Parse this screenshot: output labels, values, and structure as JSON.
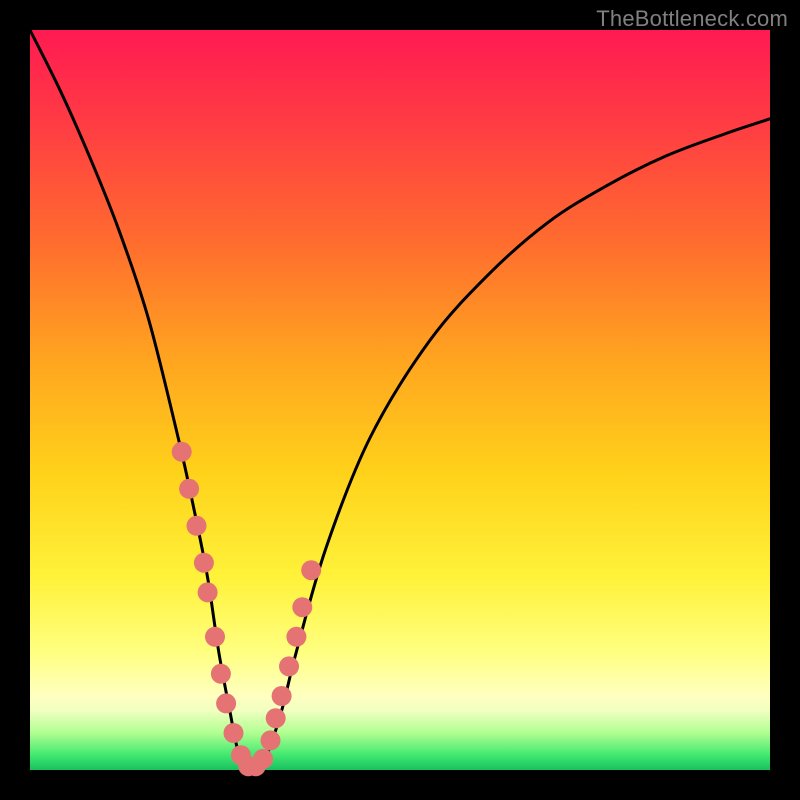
{
  "watermark": "TheBottleneck.com",
  "colors": {
    "background": "#000000",
    "curve_stroke": "#000000",
    "marker_fill": "#e57373",
    "marker_stroke": "#c85858",
    "watermark_text": "#808080"
  },
  "chart_data": {
    "type": "line",
    "title": "",
    "xlabel": "",
    "ylabel": "",
    "xlim": [
      0,
      100
    ],
    "ylim": [
      0,
      100
    ],
    "grid": false,
    "legend": false,
    "curve_comment": "V-shaped bottleneck curve; y≈0 at the notch, rises steeply toward 100 away from it. Values estimated from pixel positions.",
    "x": [
      0,
      4,
      8,
      12,
      16,
      20,
      22,
      24,
      25.5,
      27,
      28,
      29,
      30,
      31,
      32,
      34,
      36,
      40,
      46,
      54,
      62,
      70,
      78,
      86,
      94,
      100
    ],
    "y": [
      100,
      92,
      83,
      73,
      61,
      45,
      36,
      26,
      16,
      8,
      3,
      0.5,
      0,
      0.5,
      2,
      8,
      16,
      30,
      45,
      58,
      67,
      74,
      79,
      83,
      86,
      88
    ],
    "series": [
      {
        "name": "markers",
        "comment": "highlighted sample points near the notch (salmon dots)",
        "x": [
          20.5,
          21.5,
          22.5,
          23.5,
          24,
          25,
          25.8,
          26.5,
          27.5,
          28.5,
          29.5,
          30.5,
          31.5,
          32.5,
          33.2,
          34,
          35,
          36,
          36.8,
          38
        ],
        "y": [
          43,
          38,
          33,
          28,
          24,
          18,
          13,
          9,
          5,
          2,
          0.5,
          0.5,
          1.5,
          4,
          7,
          10,
          14,
          18,
          22,
          27
        ]
      }
    ]
  }
}
